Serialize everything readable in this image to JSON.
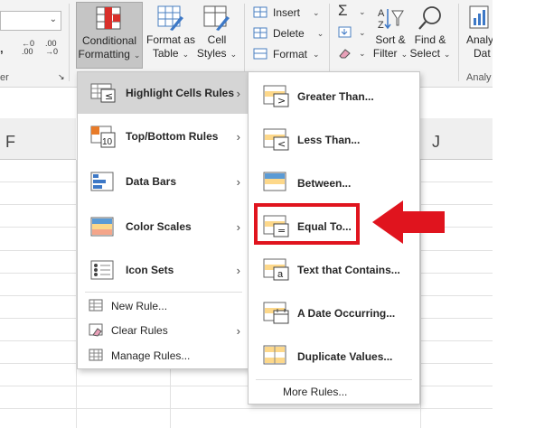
{
  "ribbon": {
    "number_group_label": "er",
    "conditional_formatting": {
      "line1": "Conditional",
      "line2": "Formatting"
    },
    "format_as_table": {
      "line1": "Format as",
      "line2": "Table"
    },
    "cell_styles": {
      "line1": "Cell",
      "line2": "Styles"
    },
    "insert_label": "Insert",
    "delete_label": "Delete",
    "format_label": "Format",
    "sort_filter": {
      "line1": "Sort &",
      "line2": "Filter"
    },
    "find_select": {
      "line1": "Find &",
      "line2": "Select"
    },
    "analyze_data": {
      "line1": "Analy",
      "line2": "Dat"
    },
    "analysis_group_label": "Analy",
    "decimal_increase": ".00",
    "decimal_decrease": ".00"
  },
  "sheet": {
    "col_f": "F",
    "col_j": "J"
  },
  "main_menu": {
    "items": [
      {
        "label": "Highlight Cells Rules",
        "has_submenu": true
      },
      {
        "label": "Top/Bottom Rules",
        "has_submenu": true
      },
      {
        "label": "Data Bars",
        "has_submenu": true
      },
      {
        "label": "Color Scales",
        "has_submenu": true
      },
      {
        "label": "Icon Sets",
        "has_submenu": true
      },
      {
        "label": "New Rule...",
        "has_submenu": false
      },
      {
        "label": "Clear Rules",
        "has_submenu": true
      },
      {
        "label": "Manage Rules...",
        "has_submenu": false
      }
    ]
  },
  "sub_menu": {
    "items": [
      {
        "label": "Greater Than..."
      },
      {
        "label": "Less Than..."
      },
      {
        "label": "Between..."
      },
      {
        "label": "Equal To..."
      },
      {
        "label": "Text that Contains..."
      },
      {
        "label": "A Date Occurring..."
      },
      {
        "label": "Duplicate Values..."
      },
      {
        "label": "More Rules..."
      }
    ]
  },
  "annotation": {
    "color": "#e0141e"
  }
}
